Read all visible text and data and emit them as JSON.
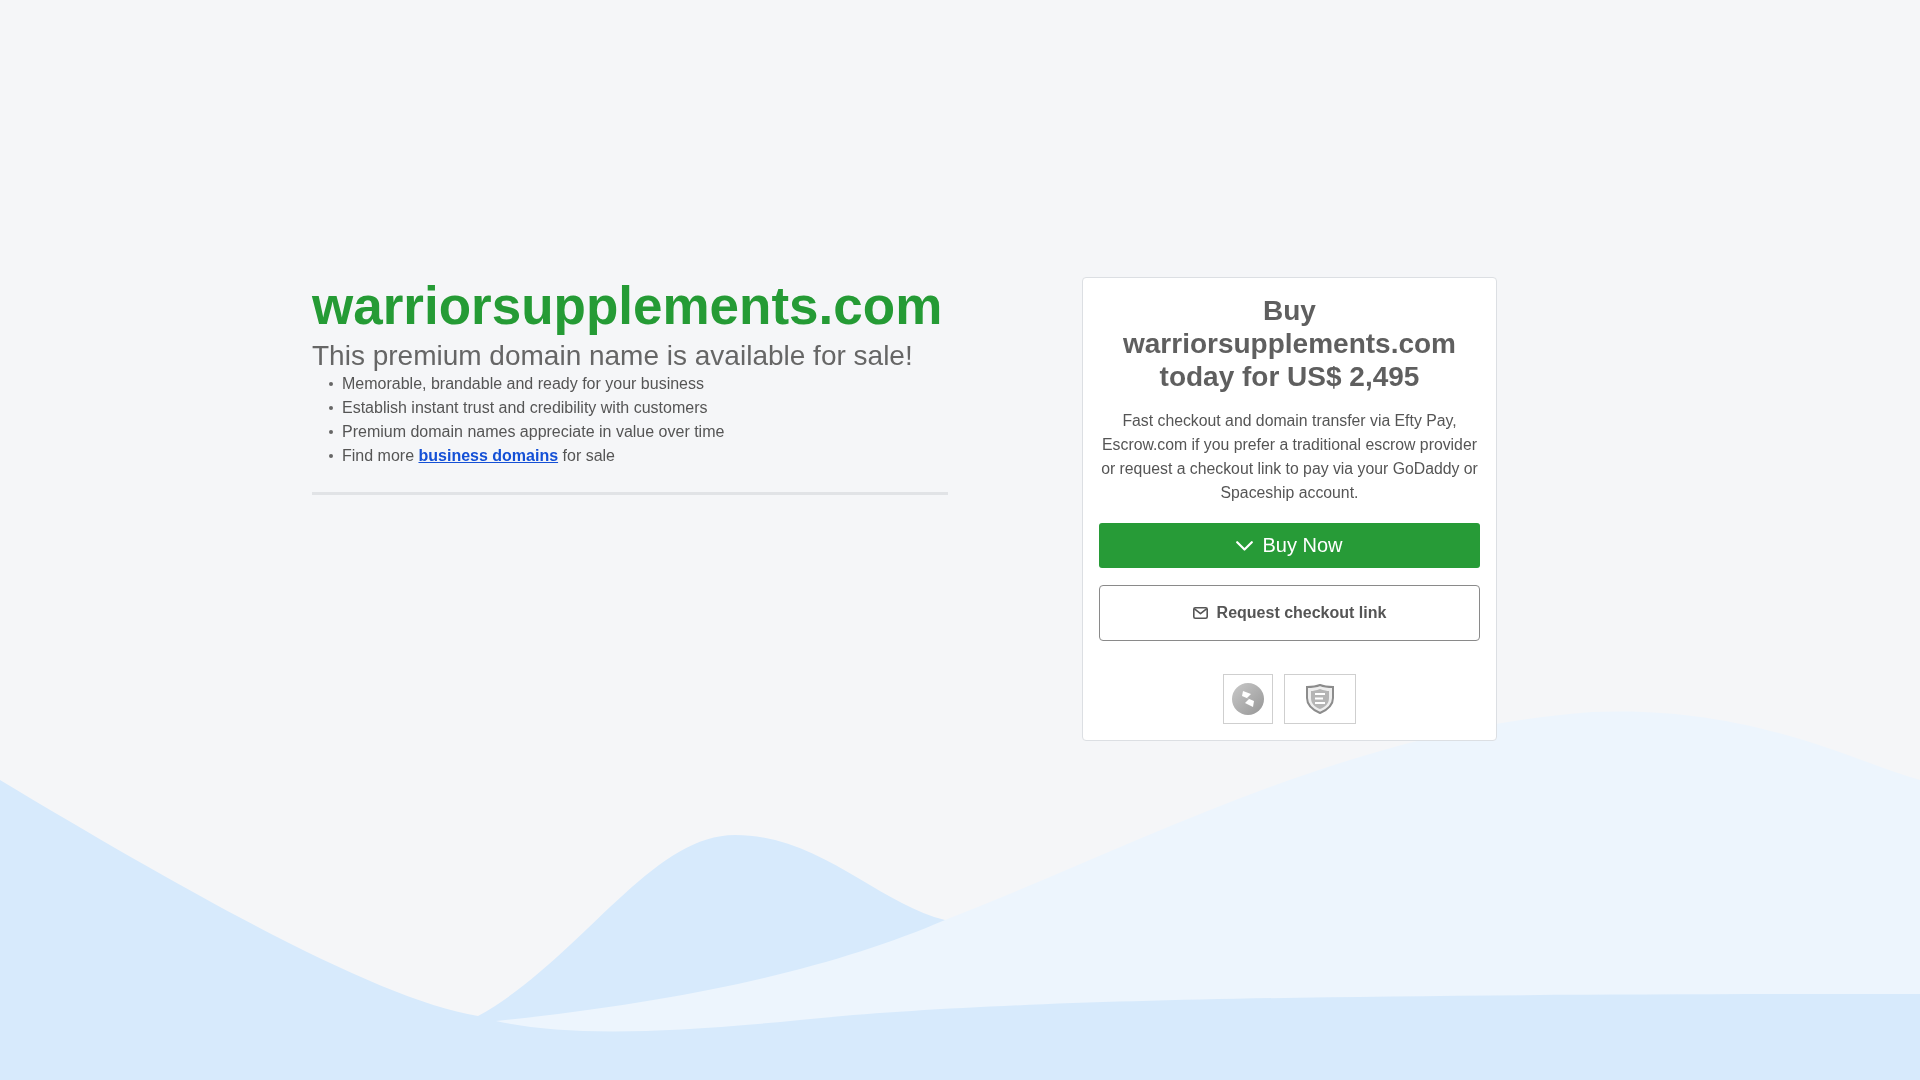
{
  "domain": {
    "name": "warriorsupplements.com",
    "tagline": "This premium domain name is available for sale!"
  },
  "features": [
    {
      "kind": "text",
      "text": "Memorable, brandable and ready for your business"
    },
    {
      "kind": "text",
      "text": "Establish instant trust and credibility with customers"
    },
    {
      "kind": "text",
      "text": "Premium domain names appreciate in value over time"
    },
    {
      "kind": "link",
      "before": "Find more",
      "link": "business domains",
      "after": "for sale"
    }
  ],
  "offer": {
    "title": "Buy warriorsupplements.com today for US$ 2,495",
    "description": "Fast checkout and domain transfer via Efty Pay, Escrow.com if you prefer a traditional escrow provider or request a checkout link to pay via your GoDaddy or Spaceship account.",
    "buttons": [
      {
        "kind": "primary",
        "label": "Buy Now"
      },
      {
        "kind": "outline",
        "label": "Request checkout link"
      }
    ]
  }
}
